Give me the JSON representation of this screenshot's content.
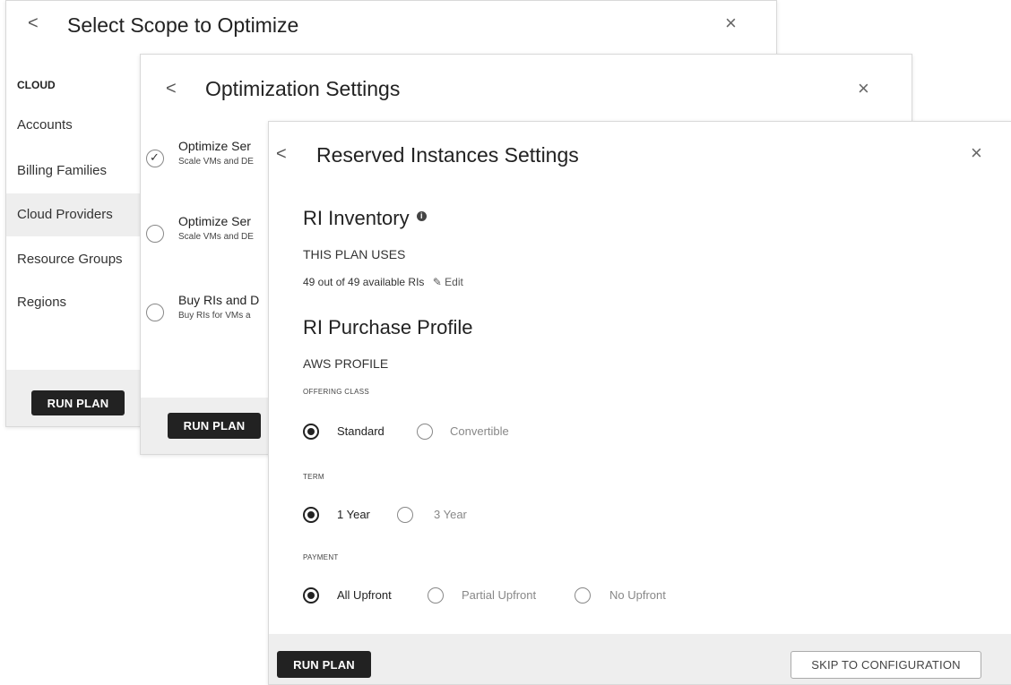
{
  "scope_panel": {
    "back": "<",
    "title": "Select Scope to Optimize",
    "close": "×",
    "nav_heading": "CLOUD",
    "nav_items": [
      "Accounts",
      "Billing Families",
      "Cloud Providers",
      "Resource Groups",
      "Regions"
    ],
    "active_item": "Cloud Providers",
    "run_plan": "RUN PLAN"
  },
  "optimization_panel": {
    "back": "<",
    "title": "Optimization Settings",
    "close": "×",
    "options": [
      {
        "title": "Optimize Ser",
        "subtitle": "Scale VMs and DE",
        "checked": true
      },
      {
        "title": "Optimize Ser",
        "subtitle": "Scale VMs and DE",
        "checked": false
      },
      {
        "title": "Buy RIs and D",
        "subtitle": "Buy RIs for VMs a",
        "checked": false
      }
    ],
    "run_plan": "RUN PLAN"
  },
  "ri_panel": {
    "back": "<",
    "title": "Reserved Instances Settings",
    "close": "×",
    "inventory": {
      "heading": "RI Inventory",
      "info_icon": "info-icon",
      "uses_label": "THIS PLAN USES",
      "usage_text": "49 out of 49 available RIs",
      "edit_label": "Edit"
    },
    "purchase_profile": {
      "heading": "RI Purchase Profile",
      "profile_label": "AWS PROFILE",
      "offering_class": {
        "label": "OFFERING CLASS",
        "options": [
          "Standard",
          "Convertible"
        ],
        "selected": "Standard"
      },
      "term": {
        "label": "TERM",
        "options": [
          "1 Year",
          "3 Year"
        ],
        "selected": "1 Year"
      },
      "payment": {
        "label": "PAYMENT",
        "options": [
          "All Upfront",
          "Partial Upfront",
          "No Upfront"
        ],
        "selected": "All Upfront"
      }
    },
    "run_plan": "RUN PLAN",
    "skip": "SKIP TO CONFIGURATION"
  }
}
